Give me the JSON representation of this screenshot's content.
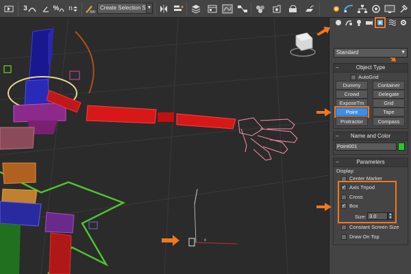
{
  "toolbar": {
    "selection_set": "Create Selection Se",
    "snap_label": "3",
    "percent_snap_label": "%",
    "spinner_snap_label": "n"
  },
  "category": "Standard",
  "object_type": {
    "title": "Object Type",
    "autogrid": "AutoGrid",
    "buttons": [
      "Dummy",
      "Container",
      "Crowd",
      "Delegate",
      "ExposeTm",
      "Grid",
      "Point",
      "Tape",
      "Protractor",
      "Compass"
    ],
    "active": "Point"
  },
  "name_and_color": {
    "title": "Name and Color",
    "name": "Point001",
    "color": "#22cc22"
  },
  "parameters": {
    "title": "Parameters",
    "display_label": "Display:",
    "center_marker": "Center Marker",
    "center_marker_checked": false,
    "axis_tripod": "Axis Tripod",
    "axis_tripod_checked": true,
    "cross": "Cross",
    "cross_checked": false,
    "box": "Box",
    "box_checked": true,
    "size_label": "Size:",
    "size_value": "3.0",
    "constant_screen_size": "Constant Screen Size",
    "constant_screen_size_checked": false,
    "draw_on_top": "Draw On Top",
    "draw_on_top_checked": false
  },
  "colors": {
    "accent": "#f07820",
    "active_button": "#3d8fe6",
    "ui_background": "#444444",
    "viewport_background": "#2b2b2b"
  },
  "icons": [
    "create-tab-icon",
    "modify-tab-icon",
    "hierarchy-tab-icon",
    "motion-tab-icon",
    "display-tab-icon",
    "utilities-tab-icon",
    "geometry-icon",
    "shapes-icon",
    "lights-icon",
    "cameras-icon",
    "helpers-icon",
    "spacewarps-icon",
    "systems-icon",
    "viewcube-icon"
  ]
}
